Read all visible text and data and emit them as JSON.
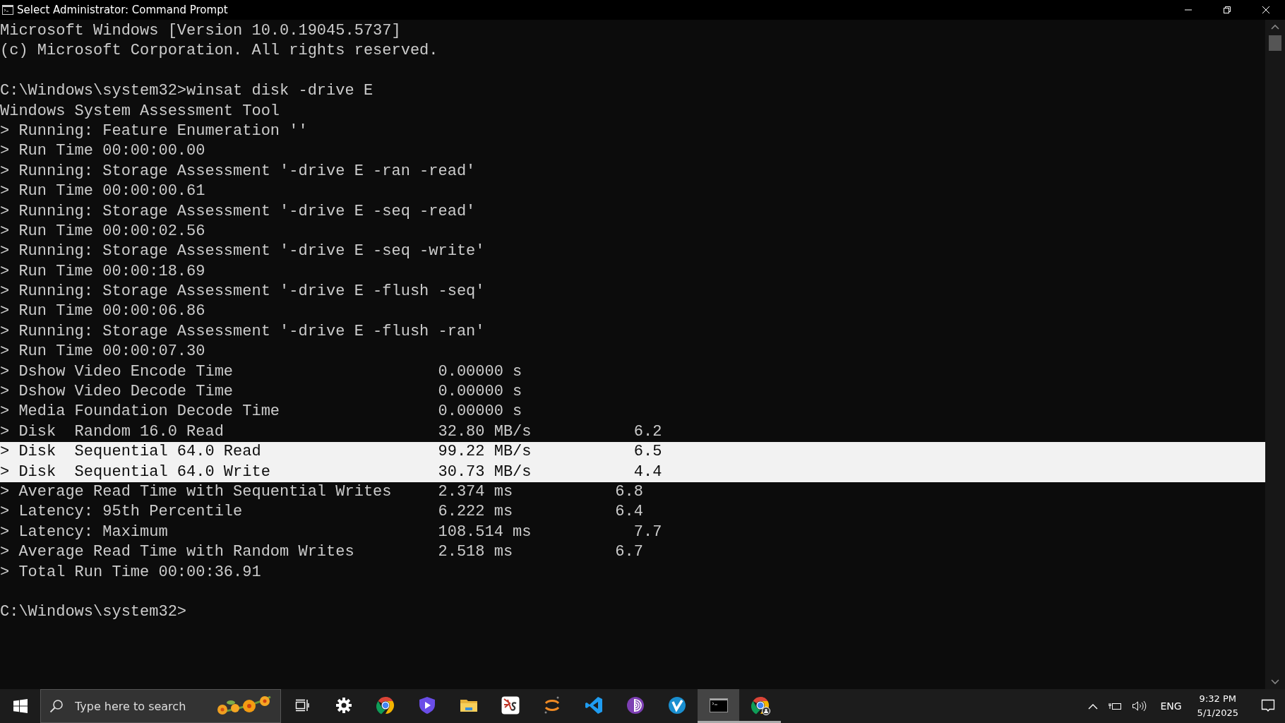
{
  "window": {
    "title": "Select Administrator: Command Prompt"
  },
  "console": {
    "lines": [
      {
        "text": "Microsoft Windows [Version 10.0.19045.5737]",
        "selected": false
      },
      {
        "text": "(c) Microsoft Corporation. All rights reserved.",
        "selected": false
      },
      {
        "text": "C:\\Windows\\system32>winsat disk -drive E",
        "selected": false,
        "blank_line_before": true
      },
      {
        "text": "Windows System Assessment Tool",
        "selected": false
      },
      {
        "text": "> Running: Feature Enumeration ''",
        "selected": false
      },
      {
        "text": "> Run Time 00:00:00.00",
        "selected": false
      },
      {
        "text": "> Running: Storage Assessment '-drive E -ran -read'",
        "selected": false
      },
      {
        "text": "> Run Time 00:00:00.61",
        "selected": false
      },
      {
        "text": "> Running: Storage Assessment '-drive E -seq -read'",
        "selected": false
      },
      {
        "text": "> Run Time 00:00:02.56",
        "selected": false
      },
      {
        "text": "> Running: Storage Assessment '-drive E -seq -write'",
        "selected": false
      },
      {
        "text": "> Run Time 00:00:18.69",
        "selected": false
      },
      {
        "text": "> Running: Storage Assessment '-drive E -flush -seq'",
        "selected": false
      },
      {
        "text": "> Run Time 00:00:06.86",
        "selected": false
      },
      {
        "text": "> Running: Storage Assessment '-drive E -flush -ran'",
        "selected": false
      },
      {
        "text": "> Run Time 00:00:07.30",
        "selected": false
      },
      {
        "text": "> Dshow Video Encode Time                      0.00000 s",
        "selected": false
      },
      {
        "text": "> Dshow Video Decode Time                      0.00000 s",
        "selected": false
      },
      {
        "text": "> Media Foundation Decode Time                 0.00000 s",
        "selected": false
      },
      {
        "text": "> Disk  Random 16.0 Read                       32.80 MB/s           6.2",
        "selected": false
      },
      {
        "text": "> Disk  Sequential 64.0 Read                   99.22 MB/s           6.5",
        "selected": true
      },
      {
        "text": "> Disk  Sequential 64.0 Write                  30.73 MB/s           4.4",
        "selected": true
      },
      {
        "text": "> Average Read Time with Sequential Writes     2.374 ms           6.8",
        "selected": false
      },
      {
        "text": "> Latency: 95th Percentile                     6.222 ms           6.4",
        "selected": false
      },
      {
        "text": "> Latency: Maximum                             108.514 ms           7.7",
        "selected": false
      },
      {
        "text": "> Average Read Time with Random Writes         2.518 ms           6.7",
        "selected": false
      },
      {
        "text": "> Total Run Time 00:00:36.91",
        "selected": false
      },
      {
        "text": "C:\\Windows\\system32>",
        "selected": false,
        "blank_line_before": true
      }
    ]
  },
  "taskbar": {
    "search": {
      "placeholder": "Type here to search"
    },
    "apps": [
      {
        "kind": "taskview",
        "selected": false,
        "running": false
      },
      {
        "kind": "settings",
        "selected": false,
        "running": false
      },
      {
        "kind": "browser",
        "selected": false,
        "running": false
      },
      {
        "kind": "shield",
        "selected": false,
        "running": false
      },
      {
        "kind": "folder",
        "selected": false,
        "running": false
      },
      {
        "kind": "tile",
        "selected": false,
        "running": false
      },
      {
        "kind": "arcs",
        "selected": false,
        "running": false
      },
      {
        "kind": "editor",
        "selected": false,
        "running": false
      },
      {
        "kind": "onion",
        "selected": false,
        "running": false
      },
      {
        "kind": "vlogo",
        "selected": false,
        "running": false
      },
      {
        "kind": "terminal",
        "selected": true,
        "running": true
      },
      {
        "kind": "profilebrowser",
        "selected": false,
        "running": true
      }
    ],
    "tray": {
      "language": "ENG",
      "time": "9:32 PM",
      "date": "5/1/2025"
    }
  }
}
